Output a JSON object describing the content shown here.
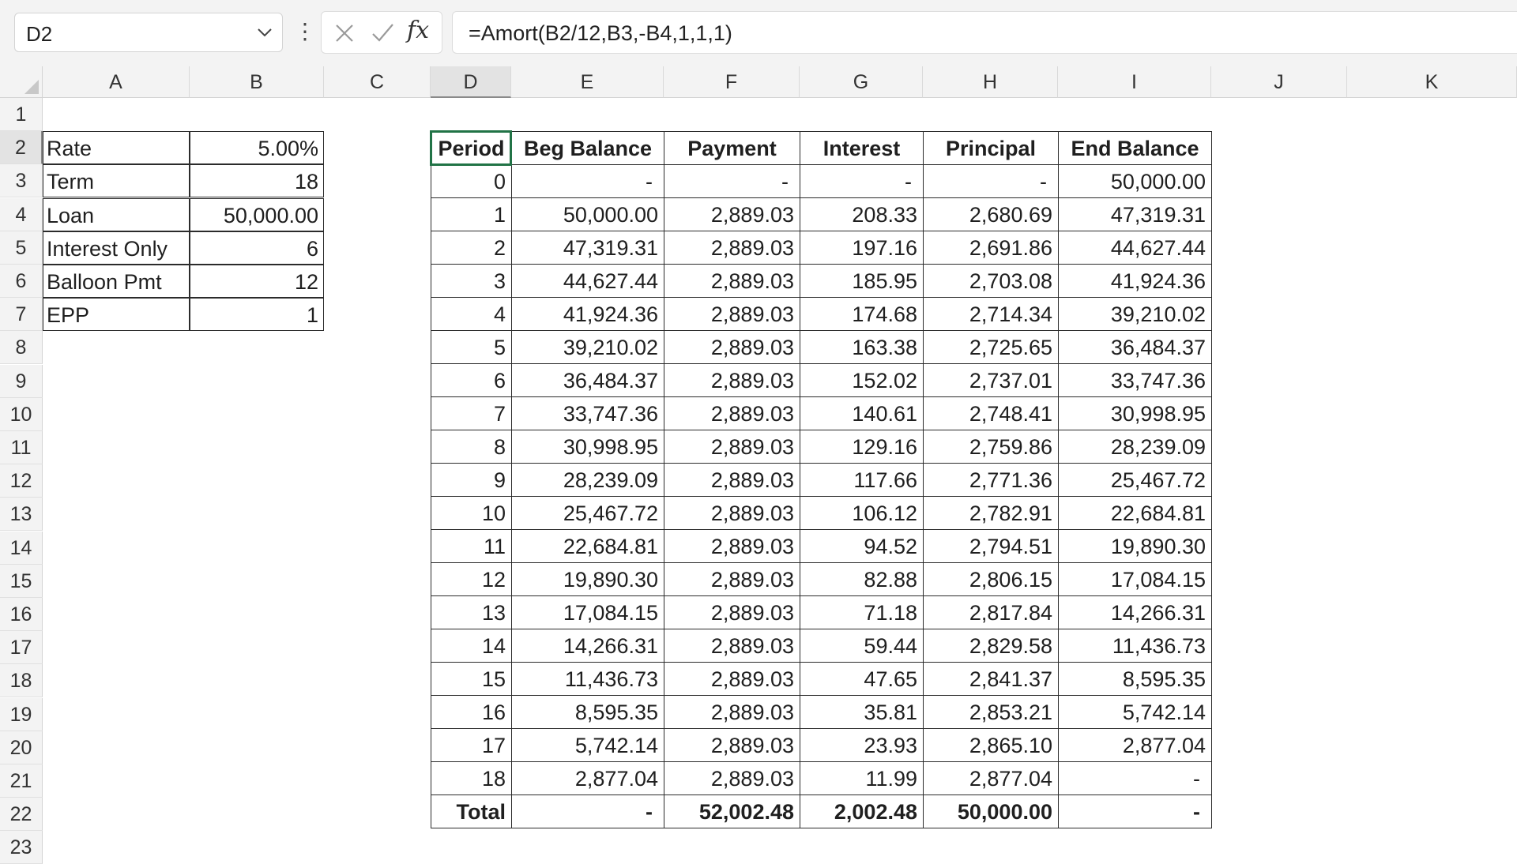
{
  "formula_bar": {
    "name_box": "D2",
    "formula": "=Amort(B2/12,B3,-B4,1,1,1)",
    "menu_glyph": "⋮",
    "fx_label": "fx"
  },
  "columns": [
    "A",
    "B",
    "C",
    "D",
    "E",
    "F",
    "G",
    "H",
    "I",
    "J",
    "K"
  ],
  "rows": [
    "1",
    "2",
    "3",
    "4",
    "5",
    "6",
    "7",
    "8",
    "9",
    "10",
    "11",
    "12",
    "13",
    "14",
    "15",
    "16",
    "17",
    "18",
    "19",
    "20",
    "21",
    "22",
    "23"
  ],
  "inputs": [
    {
      "label": "Rate",
      "value": "5.00%"
    },
    {
      "label": "Term",
      "value": "18"
    },
    {
      "label": "Loan",
      "value": "50,000.00"
    },
    {
      "label": "Interest Only",
      "value": "6"
    },
    {
      "label": "Balloon Pmt",
      "value": "12"
    },
    {
      "label": "EPP",
      "value": "1"
    }
  ],
  "amort": {
    "headers": [
      "Period",
      "Beg Balance",
      "Payment",
      "Interest",
      "Principal",
      "End Balance"
    ],
    "rows": [
      [
        "0",
        "-",
        "-",
        "-",
        "-",
        "50,000.00"
      ],
      [
        "1",
        "50,000.00",
        "2,889.03",
        "208.33",
        "2,680.69",
        "47,319.31"
      ],
      [
        "2",
        "47,319.31",
        "2,889.03",
        "197.16",
        "2,691.86",
        "44,627.44"
      ],
      [
        "3",
        "44,627.44",
        "2,889.03",
        "185.95",
        "2,703.08",
        "41,924.36"
      ],
      [
        "4",
        "41,924.36",
        "2,889.03",
        "174.68",
        "2,714.34",
        "39,210.02"
      ],
      [
        "5",
        "39,210.02",
        "2,889.03",
        "163.38",
        "2,725.65",
        "36,484.37"
      ],
      [
        "6",
        "36,484.37",
        "2,889.03",
        "152.02",
        "2,737.01",
        "33,747.36"
      ],
      [
        "7",
        "33,747.36",
        "2,889.03",
        "140.61",
        "2,748.41",
        "30,998.95"
      ],
      [
        "8",
        "30,998.95",
        "2,889.03",
        "129.16",
        "2,759.86",
        "28,239.09"
      ],
      [
        "9",
        "28,239.09",
        "2,889.03",
        "117.66",
        "2,771.36",
        "25,467.72"
      ],
      [
        "10",
        "25,467.72",
        "2,889.03",
        "106.12",
        "2,782.91",
        "22,684.81"
      ],
      [
        "11",
        "22,684.81",
        "2,889.03",
        "94.52",
        "2,794.51",
        "19,890.30"
      ],
      [
        "12",
        "19,890.30",
        "2,889.03",
        "82.88",
        "2,806.15",
        "17,084.15"
      ],
      [
        "13",
        "17,084.15",
        "2,889.03",
        "71.18",
        "2,817.84",
        "14,266.31"
      ],
      [
        "14",
        "14,266.31",
        "2,889.03",
        "59.44",
        "2,829.58",
        "11,436.73"
      ],
      [
        "15",
        "11,436.73",
        "2,889.03",
        "47.65",
        "2,841.37",
        "8,595.35"
      ],
      [
        "16",
        "8,595.35",
        "2,889.03",
        "35.81",
        "2,853.21",
        "5,742.14"
      ],
      [
        "17",
        "5,742.14",
        "2,889.03",
        "23.93",
        "2,865.10",
        "2,877.04"
      ],
      [
        "18",
        "2,877.04",
        "2,889.03",
        "11.99",
        "2,877.04",
        "-"
      ]
    ],
    "total": [
      "Total",
      "-",
      "52,002.48",
      "2,002.48",
      "50,000.00",
      "-"
    ]
  },
  "icons": {
    "name_box_dropdown": "chevron-down-icon",
    "cancel": "close-icon",
    "enter": "check-icon",
    "insert_function": "fx-icon"
  },
  "colors": {
    "selection": "#217346",
    "header_bg": "#f3f3f3"
  }
}
